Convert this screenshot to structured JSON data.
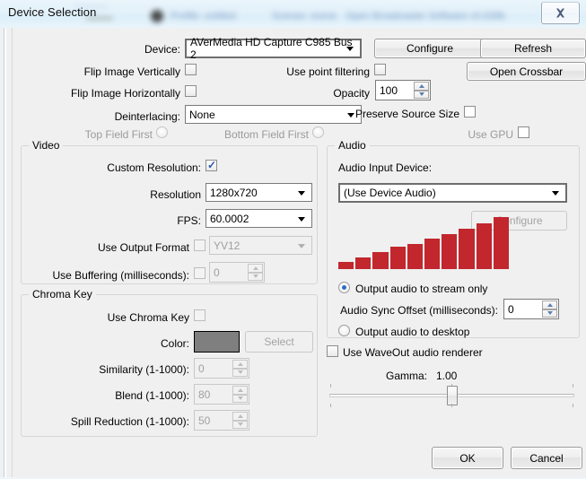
{
  "window": {
    "title": "Device Selection",
    "close_label": "close-icon",
    "background_hint": "#f0f0f0",
    "titlebar_blur_texts": [
      "Profile: untitled",
      "Scenes: scene",
      "Open Broadcaster Software v0.638b"
    ]
  },
  "top": {
    "device_label": "Device:",
    "device_value": "AVerMedia HD Capture C985 Bus 2",
    "configure_button": "Configure",
    "refresh_button": "Refresh",
    "open_crossbar_button": "Open Crossbar",
    "flip_vertically_label": "Flip Image Vertically",
    "flip_vertically_checked": false,
    "flip_horizontally_label": "Flip Image Horizontally",
    "flip_horizontally_checked": false,
    "use_point_filtering_label": "Use point filtering",
    "use_point_filtering_checked": false,
    "opacity_label": "Opacity",
    "opacity_value": "100",
    "deinterlacing_label": "Deinterlacing:",
    "deinterlacing_value": "None",
    "preserve_source_size_label": "Preserve Source Size",
    "preserve_source_size_checked": false,
    "use_gpu_label": "Use GPU",
    "use_gpu_checked": false,
    "top_field_first_label": "Top Field First",
    "top_field_first_selected": false,
    "bottom_field_first_label": "Bottom Field First",
    "bottom_field_first_selected": false
  },
  "video": {
    "group_title": "Video",
    "custom_resolution_label": "Custom Resolution:",
    "custom_resolution_checked": true,
    "resolution_label": "Resolution",
    "resolution_value": "1280x720",
    "fps_label": "FPS:",
    "fps_value": "60.0002",
    "use_output_format_label": "Use Output Format",
    "use_output_format_checked": false,
    "output_format_value": "YV12",
    "use_buffering_label": "Use Buffering (milliseconds):",
    "use_buffering_checked": false,
    "buffering_value": "0"
  },
  "chroma": {
    "group_title": "Chroma Key",
    "use_chroma_key_label": "Use Chroma Key",
    "use_chroma_key_checked": false,
    "color_label": "Color:",
    "color_value": "#7f7f7f",
    "select_button": "Select",
    "similarity_label": "Similarity (1-1000):",
    "similarity_value": "0",
    "blend_label": "Blend (1-1000):",
    "blend_value": "80",
    "spill_label": "Spill Reduction (1-1000):",
    "spill_value": "50"
  },
  "audio": {
    "group_title": "Audio",
    "input_device_label": "Audio Input Device:",
    "input_device_value": "(Use Device Audio)",
    "configure_button": "Configure",
    "meter_color": "#c1272d",
    "meter_levels": [
      8,
      13,
      19,
      25,
      28,
      34,
      39,
      45,
      51,
      58
    ],
    "output_stream_label": "Output audio to stream only",
    "output_stream_selected": true,
    "sync_offset_label": "Audio Sync Offset (milliseconds):",
    "sync_offset_value": "0",
    "output_desktop_label": "Output audio to desktop",
    "output_desktop_selected": false,
    "waveout_label": "Use WaveOut audio renderer",
    "waveout_checked": false
  },
  "gamma": {
    "label": "Gamma:",
    "value": "1.00",
    "position_percent": 50
  },
  "footer": {
    "ok_button": "OK",
    "cancel_button": "Cancel"
  }
}
